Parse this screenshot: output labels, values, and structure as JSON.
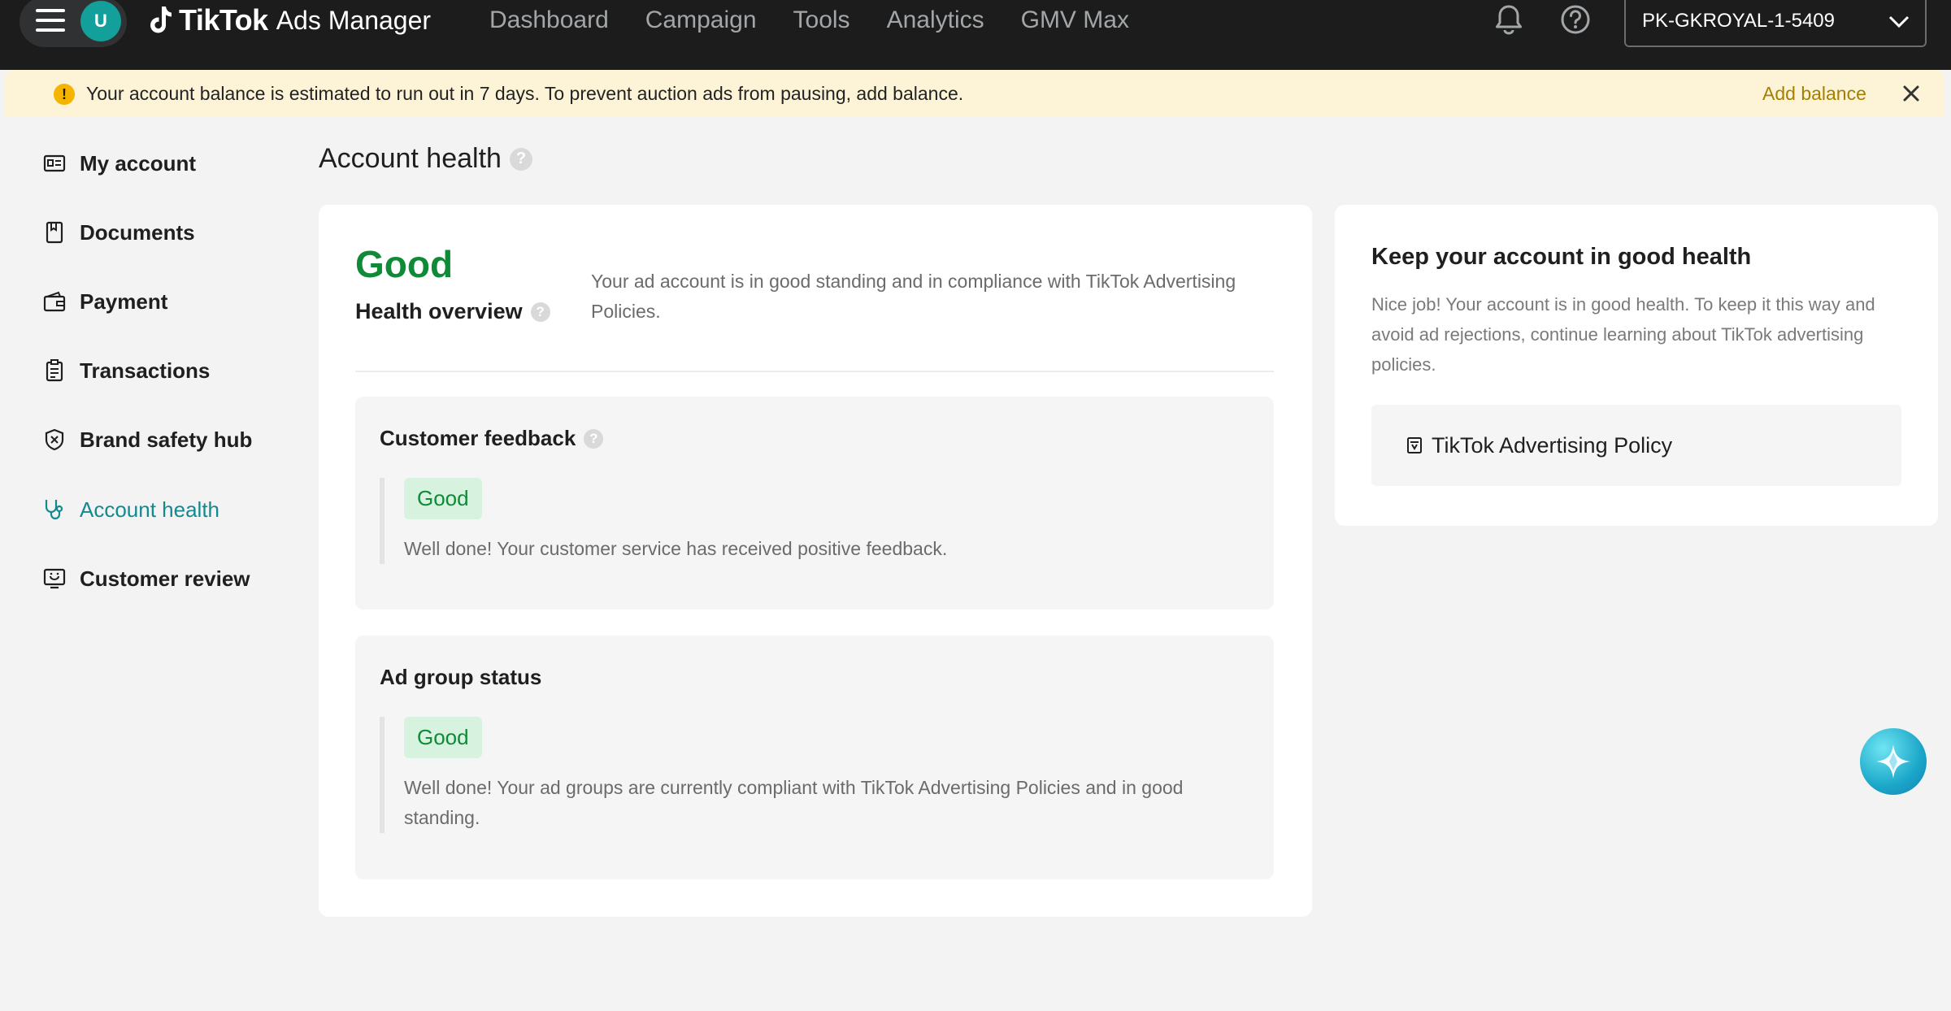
{
  "topbar": {
    "avatar_initial": "U",
    "brand": "TikTok",
    "product": "Ads Manager",
    "nav": [
      "Dashboard",
      "Campaign",
      "Tools",
      "Analytics",
      "GMV Max"
    ],
    "account_id": "PK-GKROYAL-1-5409"
  },
  "banner": {
    "icon": "!",
    "message": "Your account balance is estimated to run out in 7 days. To prevent auction ads from pausing, add balance.",
    "action": "Add balance"
  },
  "sidebar": {
    "items": [
      {
        "label": "My account",
        "icon": "id-card-icon"
      },
      {
        "label": "Documents",
        "icon": "document-icon"
      },
      {
        "label": "Payment",
        "icon": "wallet-icon"
      },
      {
        "label": "Transactions",
        "icon": "receipt-icon"
      },
      {
        "label": "Brand safety hub",
        "icon": "shield-icon"
      },
      {
        "label": "Account health",
        "icon": "stethoscope-icon",
        "active": true
      },
      {
        "label": "Customer review",
        "icon": "review-icon"
      }
    ]
  },
  "main": {
    "title": "Account health",
    "help": "?",
    "overall_status": "Good",
    "overview_label": "Health overview",
    "overview_description": "Your ad account is in good standing and in compliance with TikTok Advertising Policies.",
    "sections": [
      {
        "title": "Customer feedback",
        "status": "Good",
        "description": "Well done! Your customer service has received positive feedback."
      },
      {
        "title": "Ad group status",
        "status": "Good",
        "description": "Well done! Your ad groups are currently compliant with TikTok Advertising Policies and in good standing."
      }
    ]
  },
  "side_panel": {
    "title": "Keep your account in good health",
    "description": "Nice job! Your account is in good health. To keep it this way and avoid ad rejections, continue learning about TikTok advertising policies.",
    "link_label": "TikTok Advertising Policy"
  },
  "colors": {
    "topbar_bg": "#1c1c1c",
    "banner_bg": "#fdf4d8",
    "status_good": "#0f8a36",
    "status_good_bg": "#d7f3df",
    "active_nav": "#138a8f",
    "avatar": "#139f9a"
  }
}
